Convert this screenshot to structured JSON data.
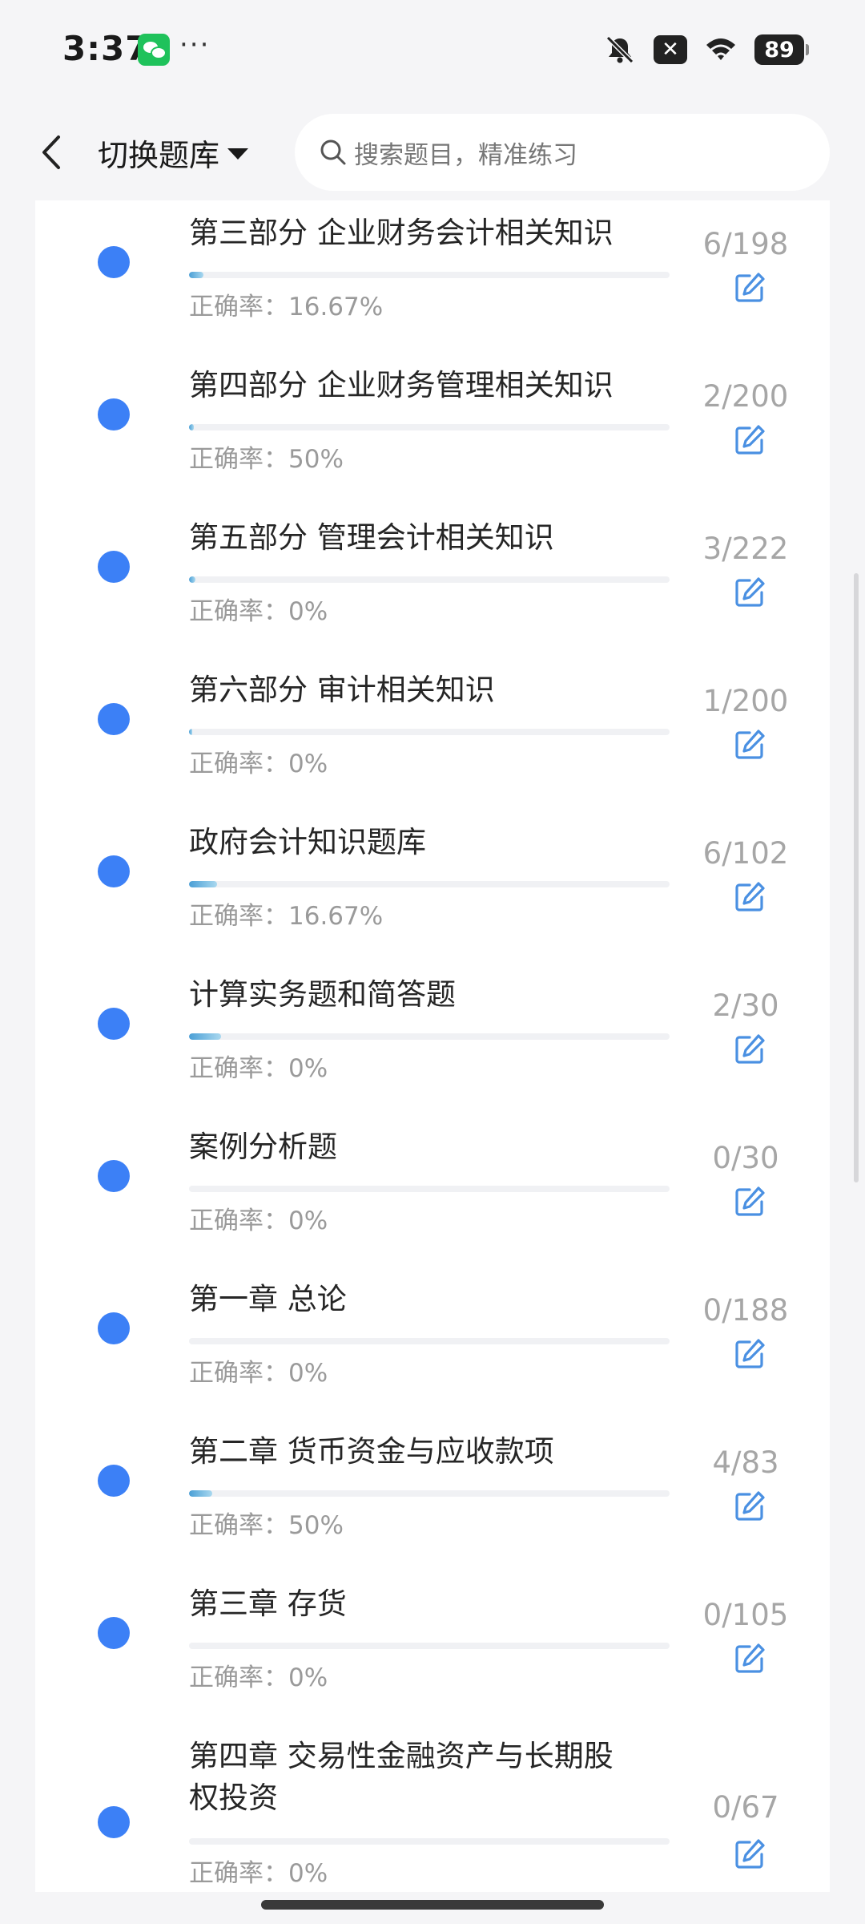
{
  "status_bar": {
    "time": "3:37",
    "dots": "···",
    "battery": "89",
    "x_badge": "✕"
  },
  "header": {
    "switch_label": "切换题库",
    "search_placeholder": "搜索题目，精准练习"
  },
  "items": [
    {
      "title_l1": "第三部分 企业财务会计相关知识",
      "title_l2": "",
      "accuracy": "正确率：16.67%",
      "count": "6/198",
      "progress": 0.03
    },
    {
      "title_l1": "第四部分 企业财务管理相关知识",
      "title_l2": "",
      "accuracy": "正确率：50%",
      "count": "2/200",
      "progress": 0.01
    },
    {
      "title_l1": "第五部分 管理会计相关知识",
      "title_l2": "",
      "accuracy": "正确率：0%",
      "count": "3/222",
      "progress": 0.013
    },
    {
      "title_l1": "第六部分 审计相关知识",
      "title_l2": "",
      "accuracy": "正确率：0%",
      "count": "1/200",
      "progress": 0.005
    },
    {
      "title_l1": "政府会计知识题库",
      "title_l2": "",
      "accuracy": "正确率：16.67%",
      "count": "6/102",
      "progress": 0.059
    },
    {
      "title_l1": "计算实务题和简答题",
      "title_l2": "",
      "accuracy": "正确率：0%",
      "count": "2/30",
      "progress": 0.067
    },
    {
      "title_l1": "案例分析题",
      "title_l2": "",
      "accuracy": "正确率：0%",
      "count": "0/30",
      "progress": 0
    },
    {
      "title_l1": "第一章 总论",
      "title_l2": "",
      "accuracy": "正确率：0%",
      "count": "0/188",
      "progress": 0
    },
    {
      "title_l1": "第二章 货币资金与应收款项",
      "title_l2": "",
      "accuracy": "正确率：50%",
      "count": "4/83",
      "progress": 0.048
    },
    {
      "title_l1": "第三章 存货",
      "title_l2": "",
      "accuracy": "正确率：0%",
      "count": "0/105",
      "progress": 0
    },
    {
      "title_l1": "第四章 交易性金融资产与长期股",
      "title_l2": "权投资",
      "accuracy": "正确率：0%",
      "count": "0/67",
      "progress": 0
    }
  ],
  "colors": {
    "dot": "#3c80f6",
    "edit_icon": "#4a90e2",
    "progress_fill": "#4a9fd6"
  }
}
